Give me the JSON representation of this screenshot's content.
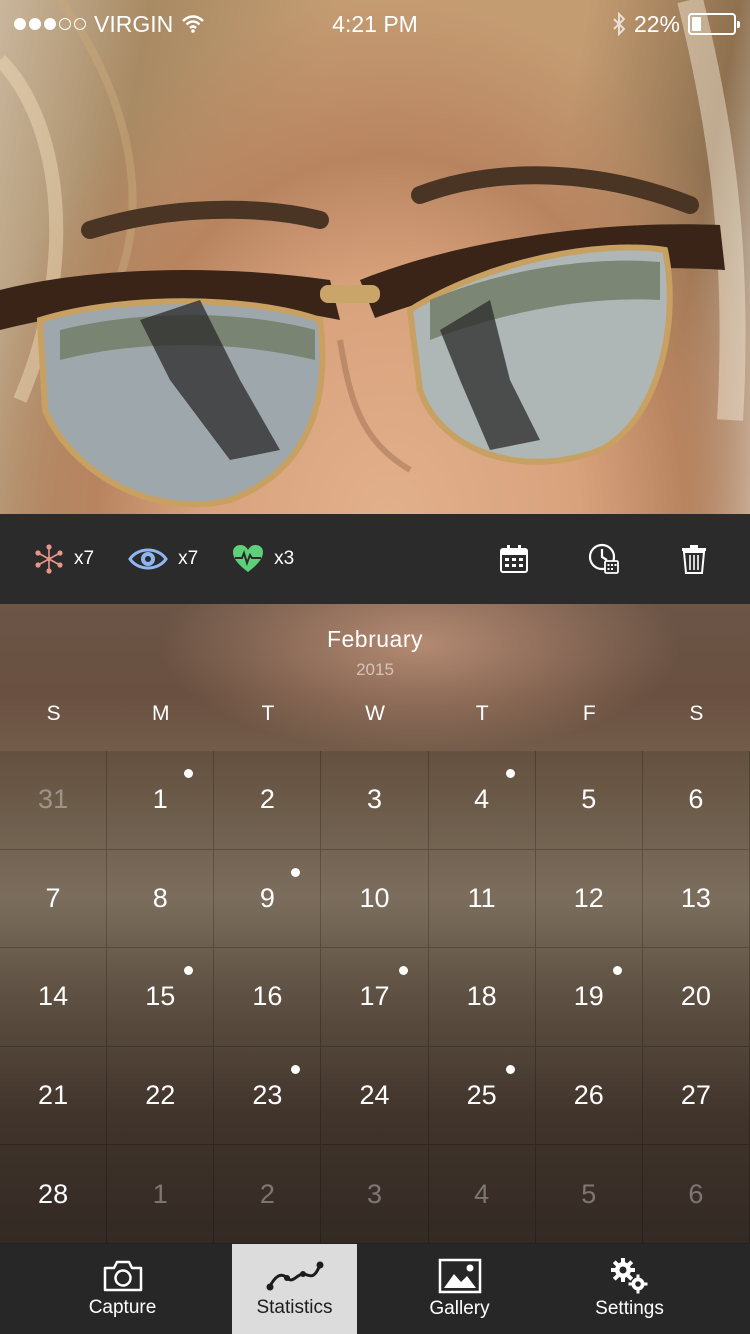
{
  "status_bar": {
    "carrier": "VIRGIN",
    "time": "4:21 PM",
    "battery": "22%",
    "battery_level": 0.22,
    "signal_bars_on": 3,
    "signal_bars_total": 5
  },
  "photo": {
    "icon": "selfie-photo"
  },
  "stats": {
    "sparkle": {
      "icon": "sparkle-icon",
      "count": "x7",
      "color": "#e8968a"
    },
    "eye": {
      "icon": "eye-icon",
      "count": "x7",
      "color": "#8fb6f0"
    },
    "heart": {
      "icon": "heart-pulse-icon",
      "count": "x3",
      "color": "#5fd07a"
    }
  },
  "toolbar_actions": [
    {
      "icon": "calendar-icon"
    },
    {
      "icon": "clock-icon"
    },
    {
      "icon": "trash-icon"
    }
  ],
  "calendar": {
    "month": "February",
    "year": "2015",
    "weekdays": [
      "S",
      "M",
      "T",
      "W",
      "T",
      "F",
      "S"
    ],
    "weeks": [
      [
        {
          "d": "31",
          "m": true
        },
        {
          "d": "1",
          "dot": true
        },
        {
          "d": "2"
        },
        {
          "d": "3"
        },
        {
          "d": "4",
          "dot": true
        },
        {
          "d": "5"
        },
        {
          "d": "6"
        }
      ],
      [
        {
          "d": "7"
        },
        {
          "d": "8"
        },
        {
          "d": "9",
          "dot": true
        },
        {
          "d": "10"
        },
        {
          "d": "11"
        },
        {
          "d": "12"
        },
        {
          "d": "13"
        }
      ],
      [
        {
          "d": "14"
        },
        {
          "d": "15",
          "dot": true
        },
        {
          "d": "16"
        },
        {
          "d": "17",
          "dot": true
        },
        {
          "d": "18"
        },
        {
          "d": "19",
          "dot": true
        },
        {
          "d": "20"
        }
      ],
      [
        {
          "d": "21"
        },
        {
          "d": "22"
        },
        {
          "d": "23",
          "dot": true
        },
        {
          "d": "24"
        },
        {
          "d": "25",
          "dot": true
        },
        {
          "d": "26"
        },
        {
          "d": "27"
        }
      ],
      [
        {
          "d": "28"
        },
        {
          "d": "1",
          "m": true
        },
        {
          "d": "2",
          "m": true
        },
        {
          "d": "3",
          "m": true
        },
        {
          "d": "4",
          "m": true
        },
        {
          "d": "5",
          "m": true
        },
        {
          "d": "6",
          "m": true
        }
      ]
    ]
  },
  "tabs": {
    "capture": {
      "label": "Capture",
      "icon": "camera-icon"
    },
    "statistics": {
      "label": "Statistics",
      "icon": "line-chart-icon",
      "active": true
    },
    "gallery": {
      "label": "Gallery",
      "icon": "image-icon"
    },
    "settings": {
      "label": "Settings",
      "icon": "gears-icon"
    }
  }
}
